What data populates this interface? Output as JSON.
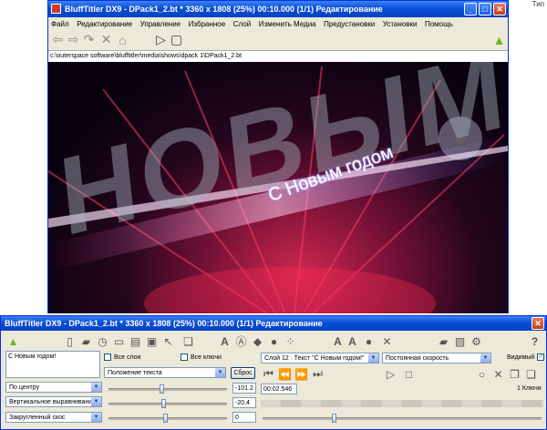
{
  "top_right_label": "Тип",
  "main_window": {
    "title": "BluffTitler DX9 - DPack1_2.bt * 3360 x 1808 (25%) 00:10.000 (1/1) Редактирование",
    "menu": [
      "Файл",
      "Редактирование",
      "Управление",
      "Избранное",
      "Слой",
      "Изменить Медиа",
      "Предустановки",
      "Установки",
      "Помощь"
    ],
    "path": "c:\\outerspace software\\blufftitler\\media\\shows\\dpack 1\\DPack1_2.bt",
    "scene_text": "С Новым годом",
    "scene_big_text": "НОВЫМ"
  },
  "control_panel": {
    "title": "BluffTitler DX9 - DPack1_2.bt * 3360 x 1808 (25%) 00:10.000 (1/1) Редактирование",
    "text_value": "С Новым годом!",
    "all_layers_label": "Все слои",
    "all_keys_label": "Все ключи",
    "layer_selector": "Слой   12  : Текст \"С Новым годом!\"",
    "speed_selector": "Постоянная скорость",
    "visible_label": "Видимый",
    "property_selector": "Положение текста",
    "reset_label": "Сброс",
    "align_center": "По центру",
    "valign": "Вертикальное выравнивание",
    "bevel": "Закругленный скос",
    "value_x": "-101.2",
    "value_y": "-20.4",
    "value_z": "0",
    "time_value": "00:02.546",
    "keys_label": "1 Ключи"
  }
}
